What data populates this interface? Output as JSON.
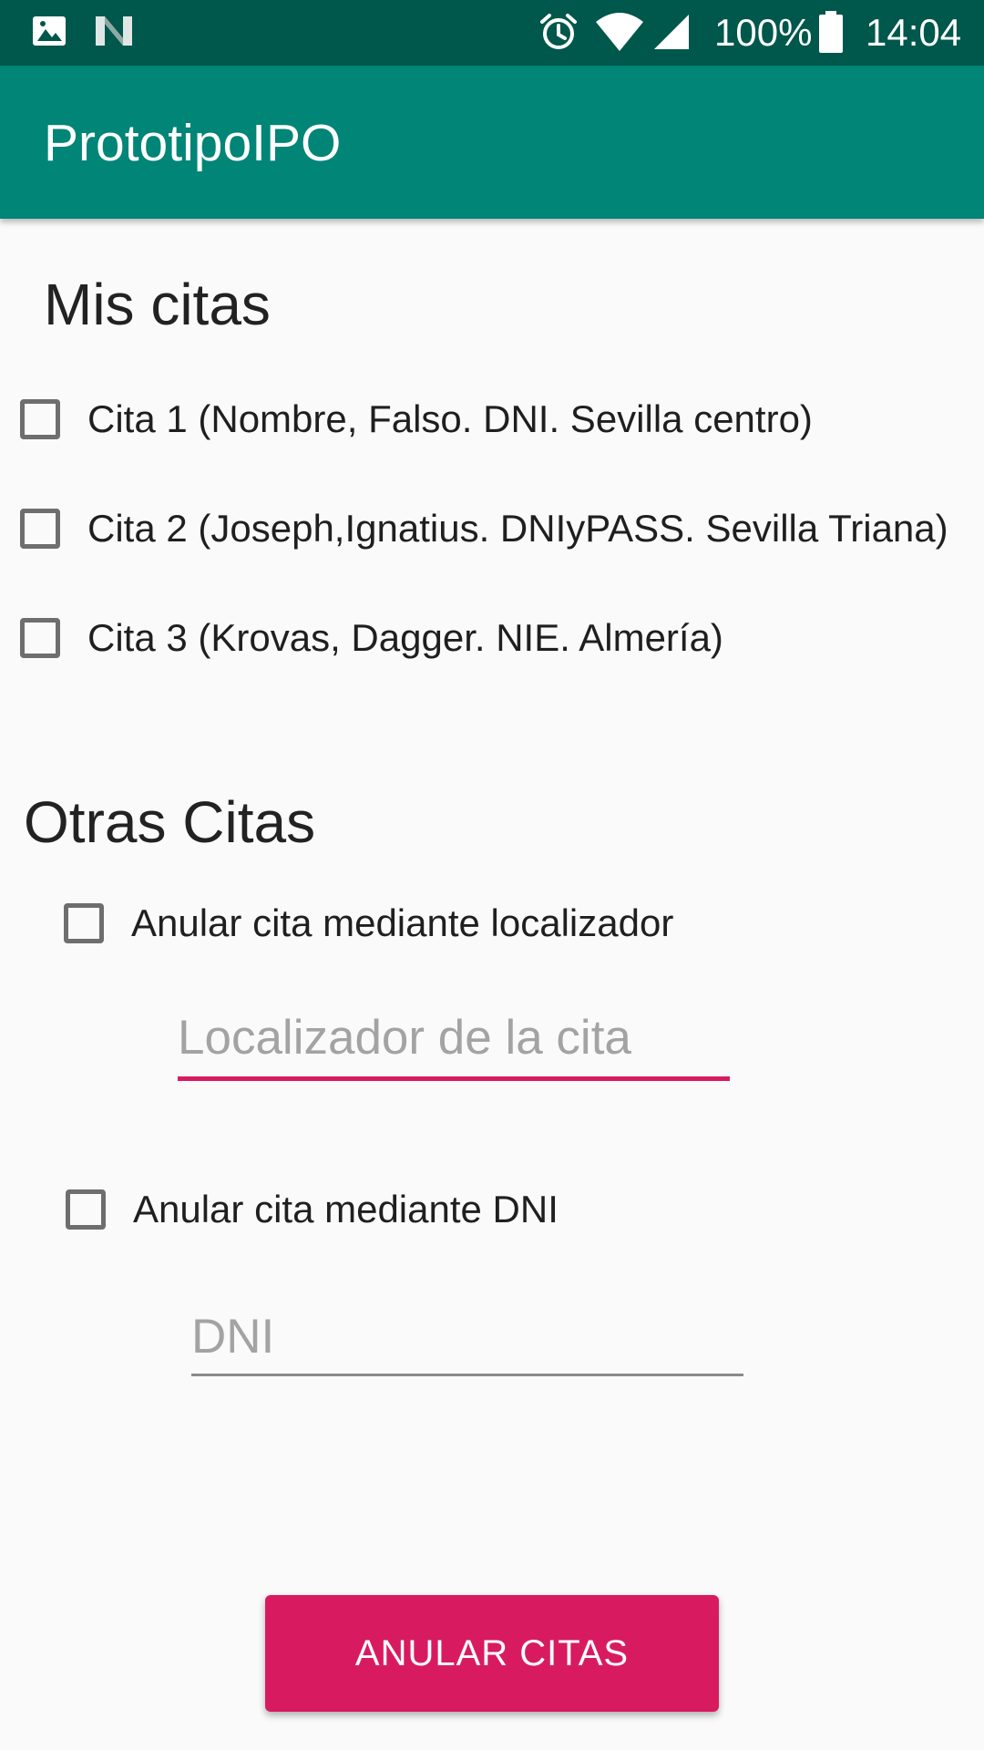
{
  "status_bar": {
    "left_icons": [
      "image-icon",
      "n-logo-icon"
    ],
    "right_icons": [
      "alarm-icon",
      "wifi-icon",
      "cell-signal-icon",
      "battery-icon"
    ],
    "battery": "100%",
    "time": "14:04",
    "background_color": "#00574b"
  },
  "app_bar": {
    "title": "PrototipoIPO",
    "background_color": "#008577"
  },
  "mis_citas": {
    "title": "Mis citas",
    "items": [
      {
        "label": "Cita 1 (Nombre, Falso. DNI. Sevilla centro)",
        "checked": false
      },
      {
        "label": "Cita 2 (Joseph,Ignatius. DNIyPASS. Sevilla Triana)",
        "checked": false
      },
      {
        "label": "Cita 3 (Krovas, Dagger. NIE. Almería)",
        "checked": false
      }
    ]
  },
  "otras_citas": {
    "title": "Otras Citas",
    "localizador": {
      "checkbox_label": "Anular cita mediante localizador",
      "checked": false,
      "input_value": "",
      "placeholder": "Localizador de la cita",
      "focused": true
    },
    "dni": {
      "checkbox_label": "Anular cita mediante DNI",
      "checked": false,
      "input_value": "",
      "placeholder": "DNI",
      "focused": false
    }
  },
  "action_button": {
    "label": "ANULAR CITAS",
    "color": "#d81b60"
  },
  "colors": {
    "accent": "#d81b60",
    "text_primary": "#222222",
    "hint": "#a3a3a3",
    "checkbox_border": "#6e6e6e"
  }
}
